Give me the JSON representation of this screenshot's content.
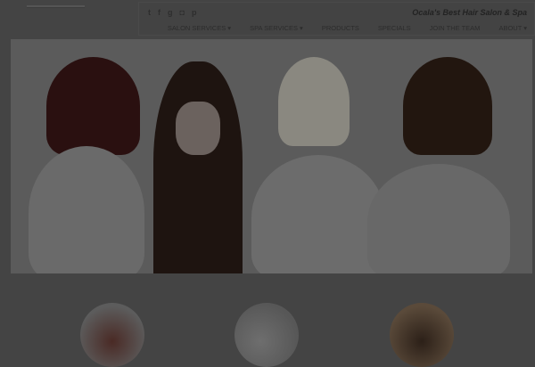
{
  "header": {
    "tagline": "Ocala's Best Hair Salon & Spa",
    "social": [
      {
        "icon": "twitter-icon",
        "glyph": "t"
      },
      {
        "icon": "facebook-icon",
        "glyph": "f"
      },
      {
        "icon": "google-plus-icon",
        "glyph": "g"
      },
      {
        "icon": "instagram-icon",
        "glyph": "◘"
      },
      {
        "icon": "pinterest-icon",
        "glyph": "p"
      }
    ],
    "nav": [
      {
        "label": "Salon Services ▾"
      },
      {
        "label": "Spa Services ▾"
      },
      {
        "label": "Products"
      },
      {
        "label": "Specials"
      },
      {
        "label": "Join the Team"
      },
      {
        "label": "About ▾"
      }
    ]
  }
}
